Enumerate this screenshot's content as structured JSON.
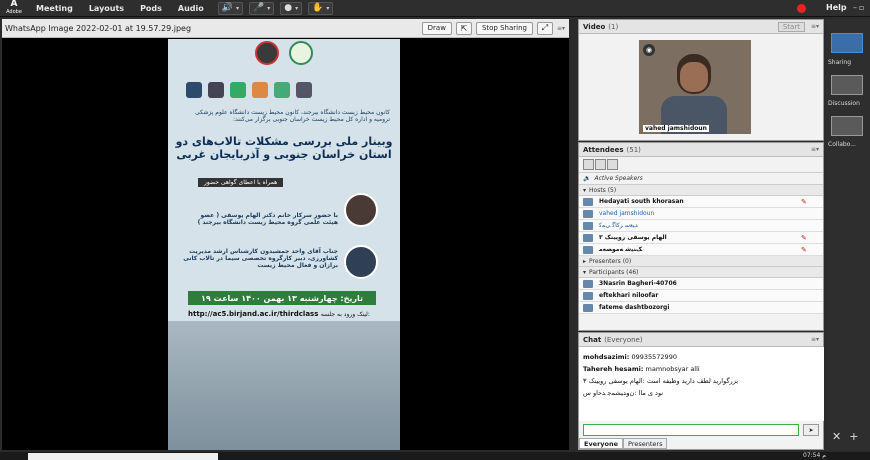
{
  "menubar": {
    "logo": "Adobe",
    "items": [
      "Meeting",
      "Layouts",
      "Pods",
      "Audio"
    ],
    "help": "Help"
  },
  "share": {
    "title": "WhatsApp Image 2022-02-01 at 19.57.29.jpeg",
    "draw_label": "Draw",
    "stop_label": "Stop Sharing"
  },
  "poster": {
    "intro": "کانون محیط زیست دانشگاه بیرجند، کانون محیط زیست دانشگاه علوم پزشکی ترومیه و اداره کل محیط زیست خراسان جنوبی برگزار می‌کنند:",
    "title": "وبینار ملی بررسی مشکلات تالاب‌های دو استان خراسان جنوبی و آذربایجان غربی",
    "pill": "همراه با اعطای گواهی حضور",
    "speaker1": "با حضور سرکار خانم دکتر الهام یوسفی ( عضو هیئت علمی گروه محیط زیست دانشگاه بیرجند )",
    "speaker2": "جناب آقای واحد جمشیدون کارشناس ارشد مدیریت کشاورزی، دبیر کارگروه تخصصی سیما در تالاب کانی برازان و فعال محیط زیست",
    "date": "تاریخ: چهارشنبه ۱۳ بهمن ۱۴۰۰ ساعت ۱۹",
    "url": "http://ac5.birjand.ac.ir/thirdclass",
    "url_label": "لینک ورود به جلسه:"
  },
  "video": {
    "title": "Video",
    "count": "(1)",
    "start_label": "Start",
    "name": "vahed jamshidoun"
  },
  "attendees": {
    "title": "Attendees",
    "count": "(51)",
    "active_speakers": "Active Speakers",
    "hosts_label": "Hosts (5)",
    "hosts": [
      "Hedayati south khorasan",
      "vahed jamshidoun",
      "ﺪﻴﻌﺳ ﺮﮐﺎﮔ ﯽﻤﮐ",
      "الهام یوسفی رویینک ۳",
      "ﮏﻨﻴﺷ ﻪﻣﻮﺼﻌﻣ"
    ],
    "presenters_label": "Presenters (0)",
    "participants_label": "Participants (46)",
    "participants": [
      "3Nasrin Bagheri-40706",
      "eftekhari niloofar",
      "fateme dashtbozorgi"
    ]
  },
  "chat": {
    "title": "Chat",
    "scope": "(Everyone)",
    "messages": [
      {
        "who": "mohdsazimi:",
        "text": "09935572990"
      },
      {
        "who": "Tahereh hesami:",
        "text": "mamnobsyar alli"
      },
      {
        "who": "",
        "text": "بزرگوارید لطف دارید وظیفه است :الهام یوسفی رویینک ۳"
      },
      {
        "who": "",
        "text": "نود ی ماا :ﻥﻭﺪﻴﺸﻤﺟ ﺪﺣﺍﻭ س"
      }
    ],
    "tab_everyone": "Everyone",
    "tab_presenters": "Presenters"
  },
  "layouts": [
    "Sharing",
    "Discussion",
    "Collabo..."
  ],
  "taskbar": {
    "time": "07:54 م"
  }
}
